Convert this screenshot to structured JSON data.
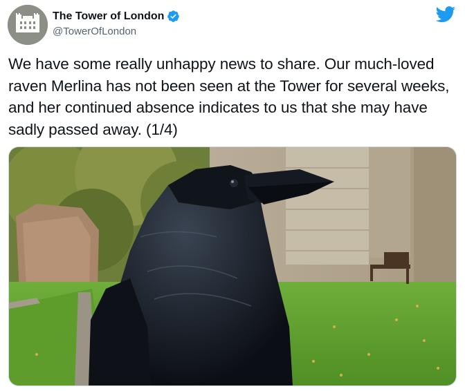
{
  "account": {
    "display_name": "The Tower of London",
    "handle": "@TowerOfLondon",
    "avatar_icon": "tower-avatar-icon",
    "verified_icon": "verified-badge-icon",
    "verified_color": "#1d9bf0"
  },
  "brand": {
    "logo_icon": "twitter-bird-icon",
    "logo_color": "#1d9bf0"
  },
  "tweet": {
    "text": "We have some really unhappy news to share. Our much-loved raven Merlina has not been seen at the Tower for several weeks, and her continued absence indicates to us that she may have sadly passed away. (1/4)"
  },
  "media": {
    "kind": "photo",
    "subject": "raven-photo"
  }
}
